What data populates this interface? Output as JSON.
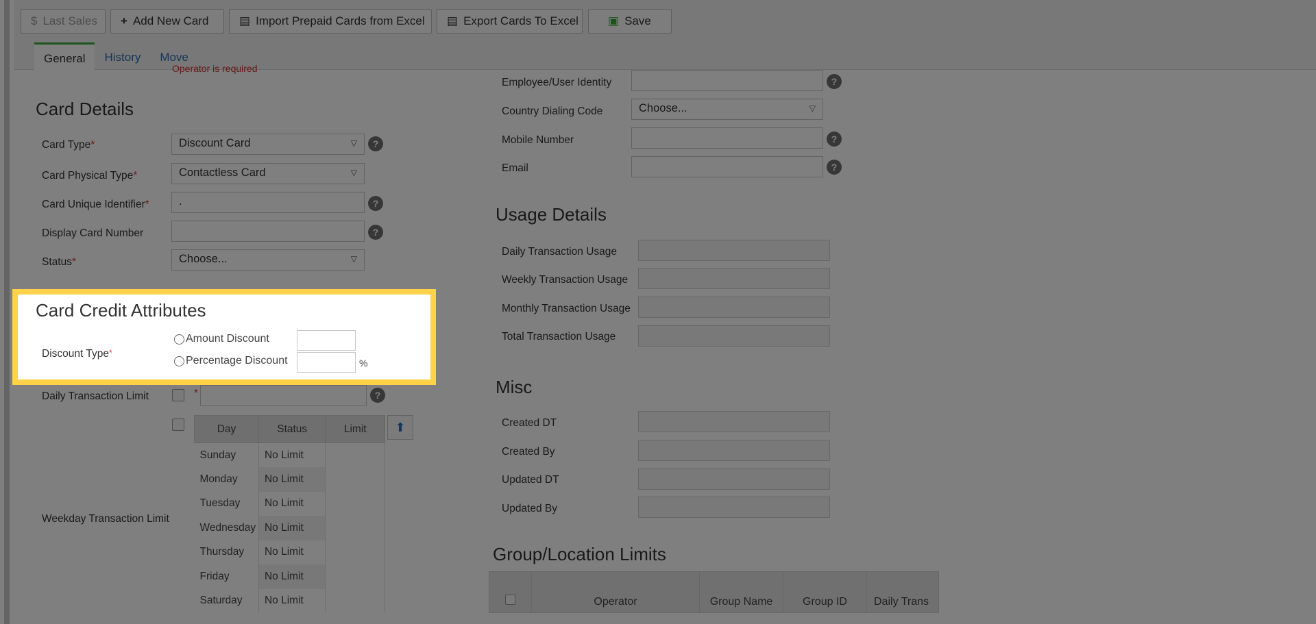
{
  "toolbar": {
    "last_sales": "Last Sales",
    "add_new_card": "Add New Card",
    "import_prepaid": "Import Prepaid Cards from Excel",
    "export_cards": "Export Cards To Excel",
    "save": "Save"
  },
  "tabs": [
    "General",
    "History",
    "Move"
  ],
  "validation_error": "Operator is required",
  "card_details": {
    "title": "Card Details",
    "card_type_label": "Card Type",
    "card_type_value": "Discount Card",
    "physical_type_label": "Card Physical Type",
    "physical_type_value": "Contactless Card",
    "unique_id_label": "Card Unique Identifier",
    "unique_id_value": ".",
    "display_number_label": "Display Card Number",
    "display_number_value": "",
    "status_label": "Status",
    "status_value": "Choose..."
  },
  "credit": {
    "title": "Card Credit Attributes",
    "discount_type_label": "Discount Type",
    "amount_discount": "Amount Discount",
    "percentage_discount": "Percentage Discount",
    "percent_sign": "%"
  },
  "limits": {
    "daily_label": "Daily Transaction Limit",
    "weekday_label": "Weekday Transaction Limit",
    "headers": [
      "Day",
      "Status",
      "Limit"
    ],
    "rows": [
      {
        "day": "Sunday",
        "status": "No Limit"
      },
      {
        "day": "Monday",
        "status": "No Limit"
      },
      {
        "day": "Tuesday",
        "status": "No Limit"
      },
      {
        "day": "Wednesday",
        "status": "No Limit"
      },
      {
        "day": "Thursday",
        "status": "No Limit"
      },
      {
        "day": "Friday",
        "status": "No Limit"
      },
      {
        "day": "Saturday",
        "status": "No Limit"
      }
    ]
  },
  "contact": {
    "employee_label": "Employee/User Identity",
    "country_code_label": "Country Dialing Code",
    "country_code_value": "Choose...",
    "mobile_label": "Mobile Number",
    "email_label": "Email"
  },
  "usage": {
    "title": "Usage Details",
    "daily": "Daily Transaction Usage",
    "weekly": "Weekly Transaction Usage",
    "monthly": "Monthly Transaction Usage",
    "total": "Total Transaction Usage"
  },
  "misc": {
    "title": "Misc",
    "created_dt": "Created DT",
    "created_by": "Created By",
    "updated_dt": "Updated DT",
    "updated_by": "Updated By"
  },
  "group": {
    "title": "Group/Location Limits",
    "headers": [
      "Operator",
      "Group Name",
      "Group ID",
      "Daily Trans"
    ]
  },
  "colors": {
    "highlight": "#ffd24a",
    "link": "#2a6bb5",
    "required": "#d33333",
    "active_tab": "#3aa63a"
  }
}
